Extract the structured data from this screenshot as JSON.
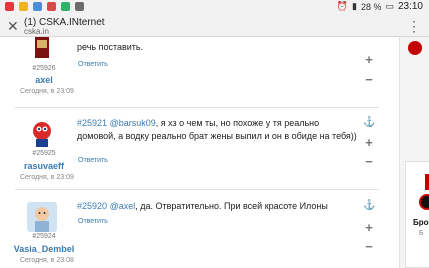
{
  "statusbar": {
    "battery": "28 %",
    "time": "23:10"
  },
  "tab": {
    "title": "(1) CSKA.INternet",
    "url": "cska.in"
  },
  "comments": [
    {
      "id": "#25926",
      "username": "axel",
      "time": "Сегодня, в 23:09",
      "reply": "Ответить",
      "text_prefix": "",
      "mention": "",
      "text": "речь поставить."
    },
    {
      "id": "#25925",
      "username": "rasuvaeff",
      "time": "Сегодня, в 23:09",
      "reply": "Ответить",
      "text_prefix": "#25921",
      "mention": "@barsuk09",
      "text": ", я хз о чем ты, но похоже у тя реально домовой, а водку реально брат жены выпил и он в обиде на тебя))"
    },
    {
      "id": "#25924",
      "username": "Vasia_Dembel",
      "time": "Сегодня, в 23:08",
      "reply": "Ответить",
      "text_prefix": "#25920",
      "mention": "@axel",
      "text": ", да. Отвратительно. При всей красоте Илоны"
    }
  ],
  "sidebar_ad": {
    "label": "Брозе",
    "sub": "Б"
  },
  "colors": {
    "link": "#3a7bb3",
    "accent_red": "#c40000"
  }
}
